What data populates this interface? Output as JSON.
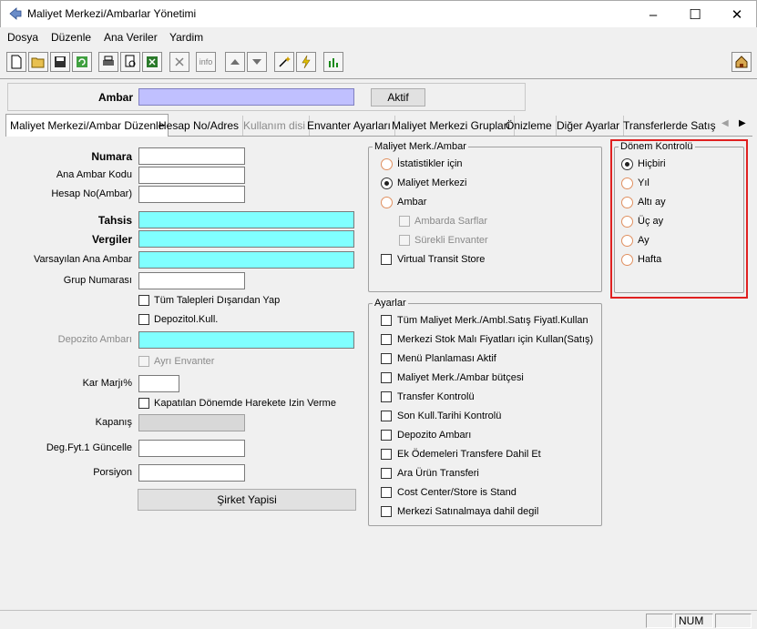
{
  "window": {
    "title": "Maliyet Merkezi/Ambarlar Yönetimi"
  },
  "menu": [
    {
      "label": "Dosya",
      "underline": "D"
    },
    {
      "label": "Düzenle",
      "underline": "D"
    },
    {
      "label": "Ana Veriler",
      "underline": "A"
    },
    {
      "label": "Yardim",
      "underline": "Y"
    }
  ],
  "toolbar": {
    "icons": [
      "new-file-icon",
      "open-folder-icon",
      "save-icon",
      "refresh-icon",
      "print-icon",
      "print-preview-icon",
      "excel-export-icon",
      "cancel-icon",
      "info-icon",
      "arrow-up-icon",
      "arrow-down-icon",
      "wand-icon",
      "lightning-icon",
      "chart-icon",
      "home-icon"
    ],
    "info_label": "info"
  },
  "ambar": {
    "label": "Ambar",
    "value": "",
    "status_button": "Aktif"
  },
  "tabs": [
    {
      "label": "Maliyet Merkezi/Ambar Düzenle",
      "active": true
    },
    {
      "label": "Hesap No/Adres"
    },
    {
      "label": "Kullanım disi",
      "disabled": true
    },
    {
      "label": "Envanter Ayarları"
    },
    {
      "label": "Maliyet Merkezi Grupları"
    },
    {
      "label": "Önizleme"
    },
    {
      "label": "Diğer Ayarlar"
    },
    {
      "label": "Transferlerde Satış Fi"
    }
  ],
  "form": {
    "numara": "Numara",
    "ana_ambar_kodu": "Ana Ambar Kodu",
    "hesap_no": "Hesap No(Ambar)",
    "tahsis": "Tahsis",
    "vergiler": "Vergiler",
    "varsayilan": "Varsayılan Ana Ambar",
    "grup_numarasi": "Grup Numarası",
    "tum_talepler": "Tüm Talepleri Dışarıdan Yap",
    "depozitol": "Depozitol.Kull.",
    "depozito_ambari": "Depozito Ambarı",
    "ayri_envanter": "Ayrı Envanter",
    "kar_marji": "Kar Marjı%",
    "kapatilan": "Kapatılan Dönemde Harekete Izin Verme",
    "kapanis": "Kapanış",
    "deg_fyt": "Deg.Fyt.1 Güncelle",
    "porsiyon": "Porsiyon",
    "sirket_button": "Şirket Yapisi"
  },
  "maliyet_group": {
    "title": "Maliyet Merk./Ambar",
    "options": [
      "İstatistikler için",
      "Maliyet Merkezi",
      "Ambar"
    ],
    "selected": 1,
    "sub": [
      "Ambarda Sarflar",
      "Sürekli Envanter"
    ],
    "virtual": "Virtual Transit Store"
  },
  "donem_group": {
    "title": "Dönem Kontrolü",
    "options": [
      "Hiçbiri",
      "Yıl",
      "Altı ay",
      "Üç ay",
      "Ay",
      "Hafta"
    ],
    "selected": 0,
    "highlight_color": "#e02020"
  },
  "ayarlar_group": {
    "title": "Ayarlar",
    "items": [
      "Tüm Maliyet Merk./Ambl.Satış Fiyatl.Kullan",
      "Merkezi Stok Malı Fiyatları için Kullan(Satış)",
      "Menü Planlaması Aktif",
      "Maliyet Merk./Ambar bütçesi",
      "Transfer Kontrolü",
      "Son Kull.Tarihi Kontrolü",
      "Depozito Ambarı",
      "Ek Ödemeleri Transfere Dahil Et",
      "Ara Ürün Transferi",
      "Cost Center/Store is Stand",
      "Merkezi Satınalmaya dahil degil"
    ]
  },
  "status": {
    "num": "NUM"
  }
}
